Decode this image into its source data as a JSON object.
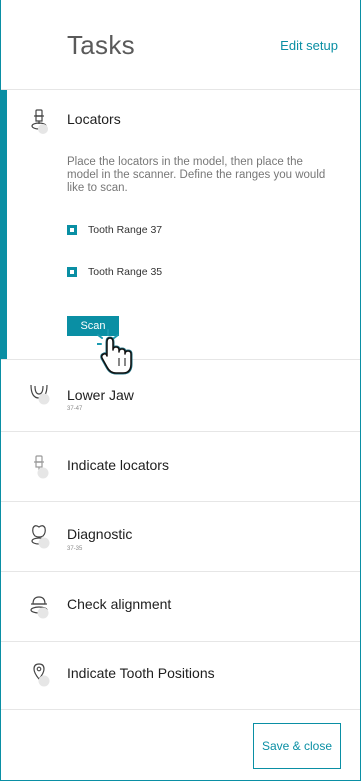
{
  "header": {
    "title": "Tasks",
    "edit_label": "Edit setup"
  },
  "active_task": {
    "label": "Locators",
    "icon": "locator-icon",
    "description": "Place the locators in the model, then place the model in the scanner. Define the ranges you would like to scan.",
    "ranges": [
      {
        "label": "Tooth Range 37",
        "checked": true
      },
      {
        "label": "Tooth Range 35",
        "checked": true
      }
    ],
    "scan_label": "Scan"
  },
  "tasks": [
    {
      "label": "Lower Jaw",
      "sub": "37-47",
      "icon": "lower-jaw-icon"
    },
    {
      "label": "Indicate locators",
      "sub": "",
      "icon": "locator-icon"
    },
    {
      "label": "Diagnostic",
      "sub": "37-35",
      "icon": "tooth-icon"
    },
    {
      "label": "Check alignment",
      "sub": "",
      "icon": "alignment-icon"
    },
    {
      "label": "Indicate Tooth Positions",
      "sub": "",
      "icon": "pin-icon"
    }
  ],
  "footer": {
    "save_label": "Save & close"
  },
  "colors": {
    "accent": "#0a8fa4",
    "status_circle": "#e6e6e6"
  }
}
